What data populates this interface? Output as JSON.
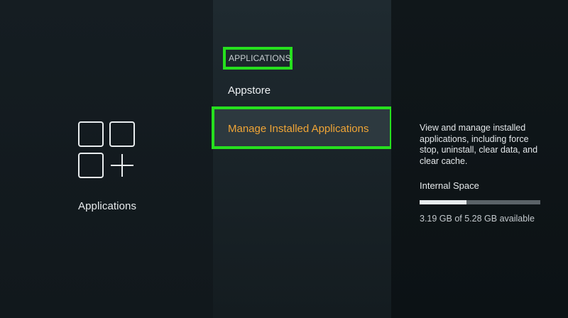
{
  "left": {
    "icon": "applications-grid-plus-icon",
    "label": "Applications"
  },
  "menu": {
    "section_header": "APPLICATIONS",
    "items": [
      {
        "label": "Appstore"
      },
      {
        "label": "Manage Installed Applications",
        "selected": true
      }
    ]
  },
  "details": {
    "description": "View and manage installed applications, including force stop, uninstall, clear data, and clear cache.",
    "storage": {
      "title": "Internal Space",
      "used_fraction": 0.39,
      "summary": "3.19 GB of 5.28 GB available"
    }
  },
  "colors": {
    "highlight_border": "#26e01e",
    "selected_text": "#f0a536",
    "selected_bg": "#2d393f"
  }
}
